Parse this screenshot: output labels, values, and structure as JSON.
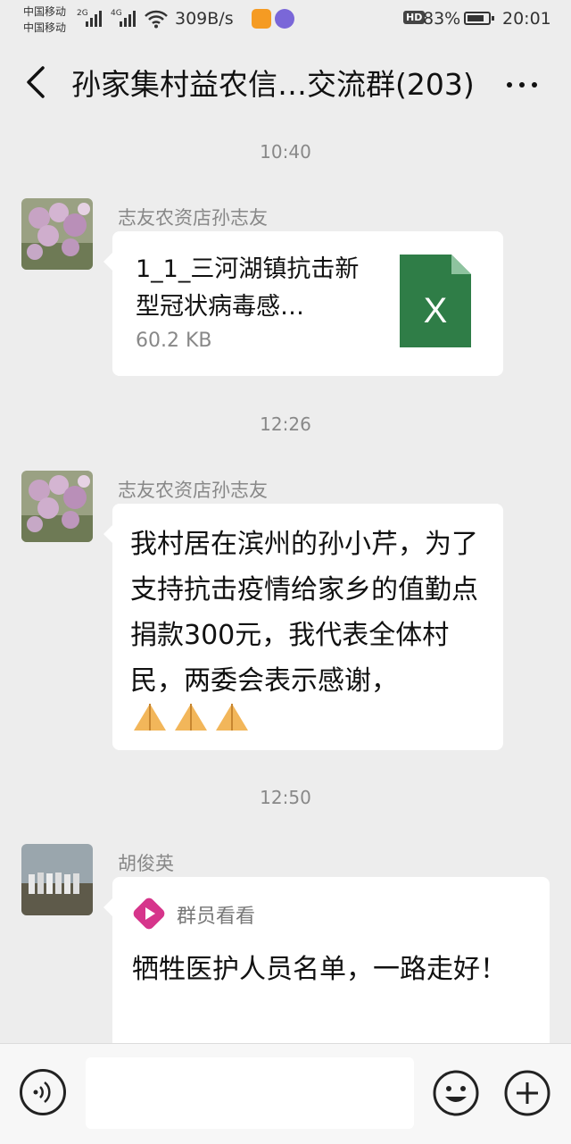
{
  "status_bar": {
    "carrier_1": "中国移动",
    "carrier_2": "中国移动",
    "sig1_tag": "2G",
    "sig2_tag": "4G",
    "net_speed": "309B/s",
    "hd_tag": "HD",
    "battery_percent": "83%",
    "battery_level": 0.83,
    "time": "20:01",
    "app_icon_1": "orange-app-icon",
    "app_icon_2": "purple-app-icon"
  },
  "header": {
    "back_icon": "chevron-left-icon",
    "title": "孙家集村益农信…交流群(203)",
    "more_icon": "more-dots-icon"
  },
  "messages": [
    {
      "time": "10:40",
      "sender": "志友农资店孙志友",
      "type": "file",
      "file_name": "1_1_三河湖镇抗击新型冠状病毒感…",
      "file_size": "60.2 KB",
      "file_icon_label": "X"
    },
    {
      "time": "12:26",
      "sender": "志友农资店孙志友",
      "type": "text",
      "text": "我村居在滨州的孙小芹，为了支持抗击疫情给家乡的值勤点捐款300元，我代表全体村民，两委会表示感谢，",
      "emojis": [
        "🙏",
        "🙏",
        "🙏"
      ]
    },
    {
      "time": "12:50",
      "sender": "胡俊英",
      "type": "share",
      "source": "群员看看",
      "title": "牺牲医护人员名单，一路走好！"
    }
  ],
  "input_bar": {
    "voice_icon": "voice-icon",
    "placeholder": "",
    "emoji_icon": "emoji-icon",
    "plus_icon": "plus-icon"
  }
}
